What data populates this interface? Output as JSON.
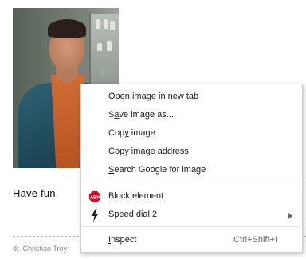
{
  "page": {
    "caption": "Have fun.",
    "author": "dr. Christian Troy"
  },
  "context_menu": {
    "items": [
      {
        "label_pre": "Open ",
        "label_u": "i",
        "label_post": "mage in new tab"
      },
      {
        "label_pre": "S",
        "label_u": "a",
        "label_post": "ve image as..."
      },
      {
        "label_pre": "Cop",
        "label_u": "y",
        "label_post": " image"
      },
      {
        "label_pre": "C",
        "label_u": "o",
        "label_post": "py image address"
      },
      {
        "label_pre": "",
        "label_u": "S",
        "label_post": "earch Google for image"
      },
      {
        "label": "Block element",
        "icon": "adblock-plus-icon",
        "icon_text": "ABP"
      },
      {
        "label": "Speed dial 2",
        "icon": "lightning-bolt-icon",
        "has_submenu": true
      },
      {
        "label_pre": "",
        "label_u": "I",
        "label_post": "nspect",
        "shortcut": "Ctrl+Shift+I"
      }
    ]
  },
  "colors": {
    "abp_red": "#c70d2c",
    "menu_border": "#cfcfcf"
  }
}
